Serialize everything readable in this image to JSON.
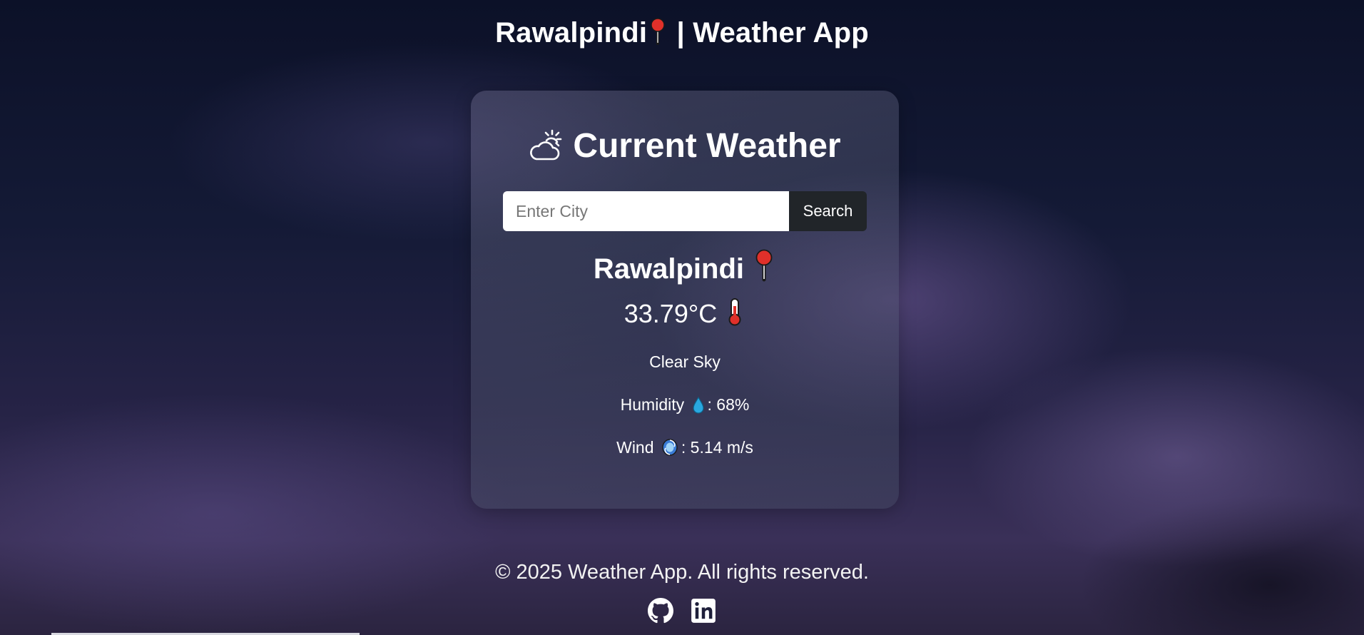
{
  "header": {
    "city": "Rawalpindi",
    "suffix": " | Weather App"
  },
  "card": {
    "heading": "Current Weather",
    "search": {
      "placeholder": "Enter City",
      "value": "",
      "button_label": "Search"
    },
    "city": "Rawalpindi",
    "temperature": "33.79°C",
    "description": "Clear Sky",
    "humidity": {
      "label": "Humidity",
      "value": ": 68%"
    },
    "wind": {
      "label": "Wind",
      "value": ": 5.14 m/s"
    }
  },
  "footer": {
    "text": "© 2025 Weather App. All rights reserved.",
    "links": [
      "github-icon",
      "linkedin-icon"
    ]
  },
  "icons": {
    "title": "pin-icon",
    "heading": "sun-behind-cloud-icon",
    "city": "pin-icon",
    "temperature": "thermometer-icon",
    "humidity": "droplet-icon",
    "wind": "cyclone-icon"
  },
  "colors": {
    "pin_red": "#e0302a",
    "button_dark": "#212529",
    "droplet_blue": "#29a8e0"
  }
}
